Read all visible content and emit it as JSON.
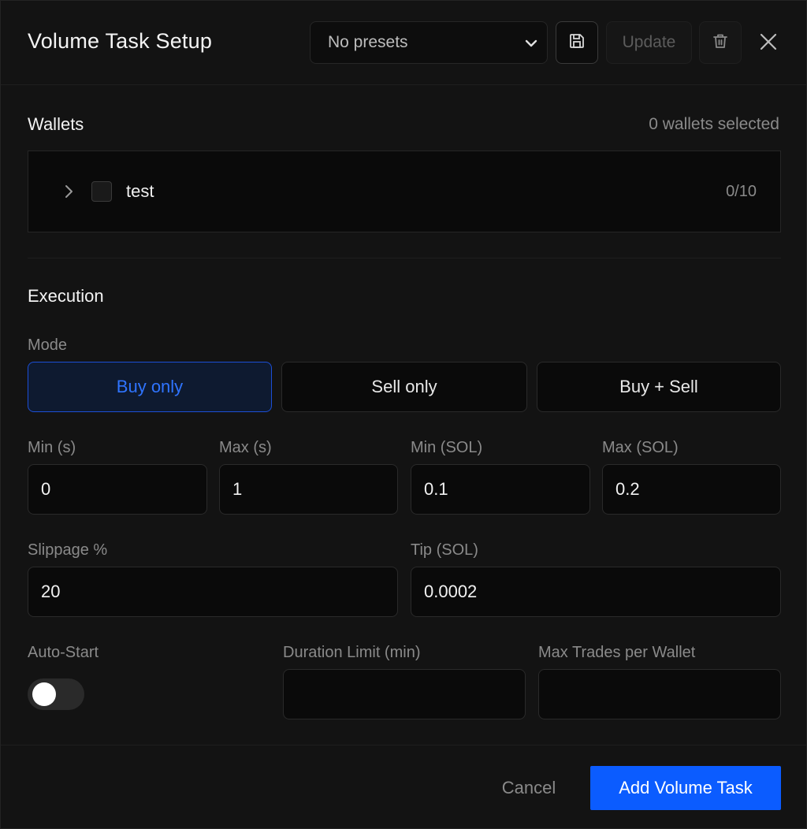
{
  "header": {
    "title": "Volume Task Setup",
    "preset_value": "No presets",
    "update_label": "Update"
  },
  "wallets": {
    "section_title": "Wallets",
    "selected_count": "0 wallets selected",
    "groups": [
      {
        "name": "test",
        "fraction": "0/10",
        "checked": false
      }
    ]
  },
  "execution": {
    "section_title": "Execution",
    "mode_label": "Mode",
    "modes": [
      "Buy only",
      "Sell only",
      "Buy + Sell"
    ],
    "active_mode": "Buy only",
    "min_s": {
      "label": "Min (s)",
      "value": "0"
    },
    "max_s": {
      "label": "Max (s)",
      "value": "1"
    },
    "min_sol": {
      "label": "Min (SOL)",
      "value": "0.1"
    },
    "max_sol": {
      "label": "Max (SOL)",
      "value": "0.2"
    },
    "slippage": {
      "label": "Slippage %",
      "value": "20"
    },
    "tip": {
      "label": "Tip (SOL)",
      "value": "0.0002"
    },
    "auto_start": {
      "label": "Auto-Start",
      "enabled": false
    },
    "duration_limit": {
      "label": "Duration Limit (min)",
      "value": ""
    },
    "max_trades": {
      "label": "Max Trades per Wallet",
      "value": ""
    }
  },
  "footer": {
    "cancel_label": "Cancel",
    "submit_label": "Add Volume Task"
  },
  "colors": {
    "accent": "#0b5cff",
    "background": "#131313",
    "active_mode_text": "#2f74ff"
  }
}
